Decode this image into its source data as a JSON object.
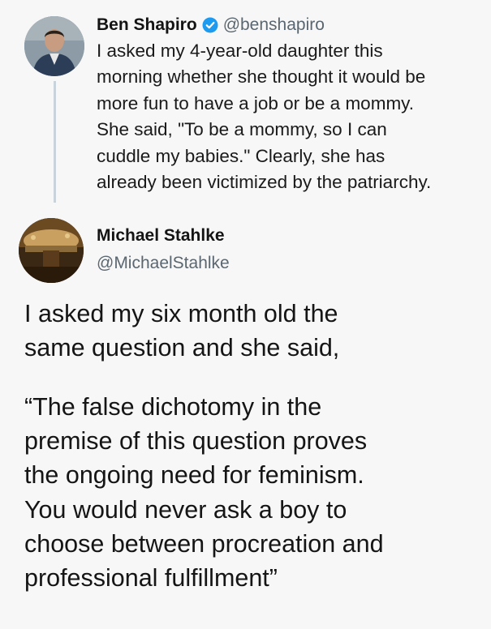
{
  "tweet_original": {
    "author_name": "Ben Shapiro",
    "handle": "@benshapiro",
    "verified_icon": "verified-badge-icon",
    "body_lines": [
      "I asked my 4-year-old daughter this",
      "morning whether she thought it would be",
      "more fun to have a job or be a mommy.",
      "She said, \"To be a mommy, so I can",
      "cuddle my babies.\" Clearly, she has",
      "already been victimized by the patriarchy."
    ]
  },
  "tweet_reply": {
    "author_name": "Michael Stahlke",
    "handle": "@MichaelStahlke",
    "paragraph1_lines": [
      "I asked my six month old the",
      "same question and she said,"
    ],
    "paragraph2_lines": [
      "“The false dichotomy in the",
      "premise of this question proves",
      "the ongoing need for feminism.",
      "You would never ask a boy to",
      "choose between procreation and",
      "professional fulfillment”"
    ]
  },
  "colors": {
    "background": "#f7f7f7",
    "verified_blue": "#1d9bf0",
    "handle_gray": "#5b6770",
    "thread_line": "#c9d3db"
  }
}
